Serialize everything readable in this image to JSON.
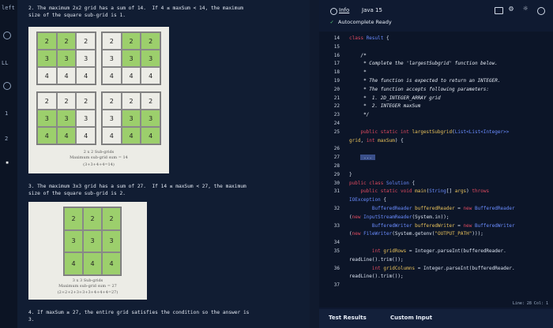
{
  "sidebar": {
    "items": [
      {
        "label": "left"
      },
      {
        "label": "LL"
      },
      {
        "label": "1"
      },
      {
        "label": "2"
      }
    ]
  },
  "problem": {
    "example2": "2. The maximum 2x2 grid has a sum of 14.  If 4 ≤ maxSum < 14, the maximum\nsize of the square sub-grid is 1.",
    "example3": "3. The maximum 3x3 grid has a sum of 27.  If 14 ≤ maxSum < 27, the maximum\nsize of the square sub-grid is 2.",
    "example4": "4. If maxSum ≥ 27, the entire grid satisfies the condition so the answer is\n3.",
    "fig1": {
      "grids": [
        {
          "rows": [
            [
              "2",
              "2",
              "2"
            ],
            [
              "3",
              "3",
              "3"
            ],
            [
              "4",
              "4",
              "4"
            ]
          ],
          "hl": [
            [
              1,
              1,
              0
            ],
            [
              1,
              1,
              0
            ],
            [
              0,
              0,
              0
            ]
          ]
        },
        {
          "rows": [
            [
              "2",
              "2",
              "2"
            ],
            [
              "3",
              "3",
              "3"
            ],
            [
              "4",
              "4",
              "4"
            ]
          ],
          "hl": [
            [
              0,
              1,
              1
            ],
            [
              0,
              1,
              1
            ],
            [
              0,
              0,
              0
            ]
          ]
        },
        {
          "rows": [
            [
              "2",
              "2",
              "2"
            ],
            [
              "3",
              "3",
              "3"
            ],
            [
              "4",
              "4",
              "4"
            ]
          ],
          "hl": [
            [
              0,
              0,
              0
            ],
            [
              1,
              1,
              0
            ],
            [
              1,
              1,
              0
            ]
          ]
        },
        {
          "rows": [
            [
              "2",
              "2",
              "2"
            ],
            [
              "3",
              "3",
              "3"
            ],
            [
              "4",
              "4",
              "4"
            ]
          ],
          "hl": [
            [
              0,
              0,
              0
            ],
            [
              0,
              1,
              1
            ],
            [
              0,
              1,
              1
            ]
          ]
        }
      ],
      "caption1": "2 x 2 Sub-grids",
      "caption2": "Maximum sub-grid sum = 14",
      "caption3": "(3+3+4+4=14)"
    },
    "fig2": {
      "grid": {
        "rows": [
          [
            "2",
            "2",
            "2"
          ],
          [
            "3",
            "3",
            "3"
          ],
          [
            "4",
            "4",
            "4"
          ]
        ],
        "hl": [
          [
            1,
            1,
            1
          ],
          [
            1,
            1,
            1
          ],
          [
            1,
            1,
            1
          ]
        ]
      },
      "caption1": "3 x 3 Sub-grids",
      "caption2": "Maximum sub-grid sum = 27",
      "caption3": "(2+2+2+3+3+3+4+4+4=27)"
    }
  },
  "editor": {
    "info_label": "Info",
    "language": "Java 15",
    "autocomplete": "Autocomplete Ready",
    "lines": [
      {
        "n": "14",
        "html": "<span class='kw'>class</span> <span class='ty'>Result</span> {"
      },
      {
        "n": "15",
        "html": ""
      },
      {
        "n": "16",
        "html": "    <span class='cm'>/*</span>"
      },
      {
        "n": "17",
        "html": "     <span class='cm'>* Complete the 'largestSubgrid' function below.</span>"
      },
      {
        "n": "18",
        "html": "     <span class='cm'>*</span>"
      },
      {
        "n": "19",
        "html": "     <span class='cm'>* The function is expected to return an INTEGER.</span>"
      },
      {
        "n": "20",
        "html": "     <span class='cm'>* The function accepts following parameters:</span>"
      },
      {
        "n": "21",
        "html": "     <span class='cm'>*  1. 2D_INTEGER_ARRAY grid</span>"
      },
      {
        "n": "22",
        "html": "     <span class='cm'>*  2. INTEGER maxSum</span>"
      },
      {
        "n": "23",
        "html": "     <span class='cm'>*/</span>"
      },
      {
        "n": "24",
        "html": ""
      },
      {
        "n": "25",
        "html": "    <span class='kw'>public static int</span> <span class='st'>largestSubgrid</span>(<span class='ty'>List&lt;List&lt;Integer&gt;&gt;</span>"
      },
      {
        "n": "",
        "html": "<span class='st'>grid</span>, <span class='kw'>int</span> <span class='st'>maxSum</span>) {"
      },
      {
        "n": "26",
        "html": ""
      },
      {
        "n": "27",
        "html": "    <span style='background:#3a4f8a;color:#cde'> ... </span>"
      },
      {
        "n": "28",
        "html": ""
      },
      {
        "n": "29",
        "html": "}"
      },
      {
        "n": "30",
        "html": "<span class='kw'>public class</span> <span class='ty'>Solution</span> {"
      },
      {
        "n": "31",
        "html": "    <span class='kw'>public static void</span> <span class='st'>main</span>(<span class='ty'>String</span>[] <span class='st'>args</span>) <span class='kw'>throws</span>"
      },
      {
        "n": "",
        "html": "<span class='ty'>IOException</span> {"
      },
      {
        "n": "32",
        "html": "        <span class='ty'>BufferedReader</span> <span class='st'>bufferedReader</span> = <span class='kw'>new</span> <span class='ty'>BufferedReader</span>"
      },
      {
        "n": "",
        "html": "(<span class='kw'>new</span> <span class='ty'>InputStreamReader</span>(System.in));"
      },
      {
        "n": "33",
        "html": "        <span class='ty'>BufferedWriter</span> <span class='st'>bufferedWriter</span> = <span class='kw'>new</span> <span class='ty'>BufferedWriter</span>"
      },
      {
        "n": "",
        "html": "(<span class='kw'>new</span> <span class='ty'>FileWriter</span>(System.getenv(<span class='st'>\"OUTPUT_PATH\"</span>)));"
      },
      {
        "n": "34",
        "html": ""
      },
      {
        "n": "35",
        "html": "        <span class='kw'>int</span> <span class='st'>gridRows</span> = Integer.parseInt(bufferedReader."
      },
      {
        "n": "",
        "html": "readLine().trim());"
      },
      {
        "n": "36",
        "html": "        <span class='kw'>int</span> <span class='st'>gridColumns</span> = Integer.parseInt(bufferedReader."
      },
      {
        "n": "",
        "html": "readLine().trim());"
      },
      {
        "n": "37",
        "html": ""
      }
    ],
    "status_hint": "Line: 28  Col: 1"
  },
  "bottom": {
    "test_results": "Test Results",
    "custom_input": "Custom Input"
  }
}
